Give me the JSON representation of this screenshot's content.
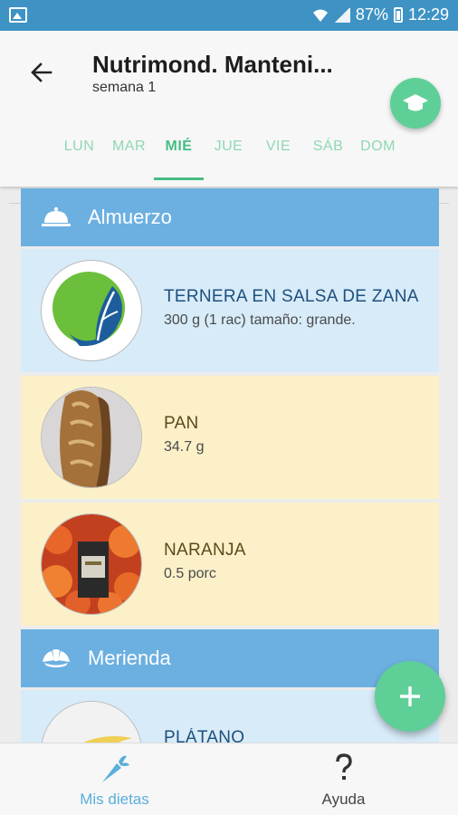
{
  "status": {
    "battery": "87%",
    "time": "12:29"
  },
  "header": {
    "title": "Nutrimond. Manteni...",
    "subtitle": "semana 1"
  },
  "tabs": [
    {
      "label": "LUN"
    },
    {
      "label": "MAR"
    },
    {
      "label": "MIÉ"
    },
    {
      "label": "JUE"
    },
    {
      "label": "VIE"
    },
    {
      "label": "SÁB"
    },
    {
      "label": "DOM"
    }
  ],
  "sections": [
    {
      "title": "Almuerzo",
      "items": [
        {
          "name": "TERNERA EN SALSA DE ZANAHORIA",
          "qty": "300 g (1 rac) tamaño: grande."
        },
        {
          "name": "PAN",
          "qty": "34.7 g"
        },
        {
          "name": "NARANJA",
          "qty": "0.5 porc"
        }
      ]
    },
    {
      "title": "Merienda",
      "items": [
        {
          "name": "PLÁTANO"
        }
      ]
    }
  ],
  "bottom_nav": {
    "diets": "Mis dietas",
    "help": "Ayuda"
  },
  "colors": {
    "accent": "#5fcf98",
    "header_blue": "#6cb0e1",
    "status": "#3e93c4"
  }
}
